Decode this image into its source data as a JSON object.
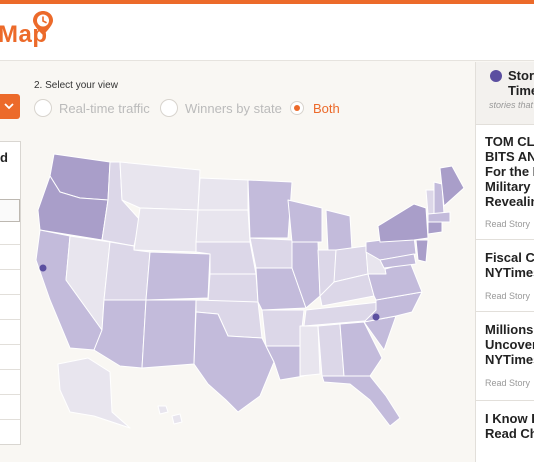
{
  "header": {
    "title": "Map"
  },
  "view_selector": {
    "label": "2. Select your view",
    "options": [
      {
        "label": "Real-time traffic",
        "selected": false
      },
      {
        "label": "Winners by state",
        "selected": false
      },
      {
        "label": "Both",
        "selected": true
      }
    ]
  },
  "left_panel": {
    "heading": "d"
  },
  "map": {
    "fill_colors": {
      "dark": "#a99ec9",
      "medium": "#c3bbdb",
      "light": "#dcd7e8",
      "pale": "#e8e5ee"
    },
    "markers": [
      {
        "name": "california-marker"
      },
      {
        "name": "south-carolina-marker"
      }
    ]
  },
  "stories_panel": {
    "title_line1": "Stori",
    "title_line2": "Time",
    "subtitle": "stories that",
    "stories": [
      {
        "lines": [
          "TOM CLA",
          "BITS AND",
          "For the P",
          "Military S",
          "Revealin"
        ],
        "link": "Read Story"
      },
      {
        "lines": [
          "Fiscal Cri",
          "NYTimes"
        ],
        "link": "Read Story"
      },
      {
        "lines": [
          "Millions o",
          "Uncovere",
          "NYTimes"
        ],
        "link": "Read Story"
      },
      {
        "lines": [
          "I Know H",
          "Read Che"
        ],
        "link": ""
      }
    ]
  },
  "colors": {
    "accent": "#ec6a2a",
    "story_dot": "#5b4fa0"
  }
}
